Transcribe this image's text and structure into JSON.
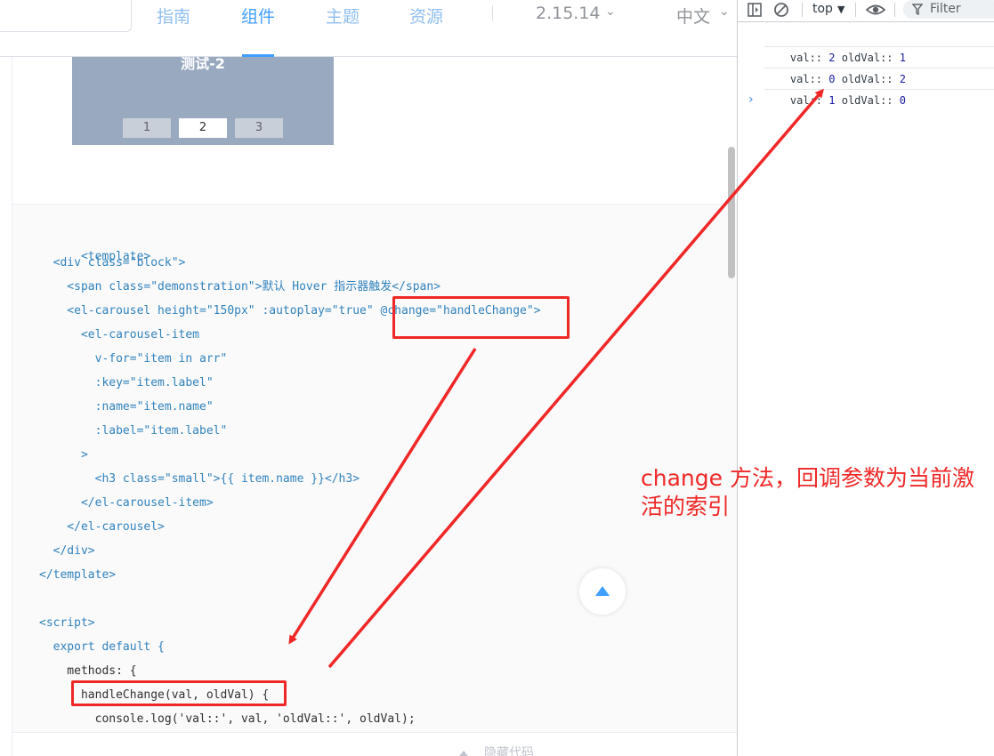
{
  "topnav": {
    "items": [
      "指南",
      "组件",
      "主题",
      "资源"
    ],
    "active_index": 1,
    "version": "2.15.14",
    "language": "中文"
  },
  "carousel": {
    "title": "测试-2",
    "indicators": [
      "1",
      "2",
      "3"
    ],
    "active_index": 1
  },
  "code": {
    "lines": [
      "<template>",
      "  <div class=\"block\">",
      "    <span class=\"demonstration\">默认 Hover 指示器触发</span>",
      "    <el-carousel height=\"150px\" :autoplay=\"true\" @change=\"handleChange\">",
      "      <el-carousel-item",
      "        v-for=\"item in arr\"",
      "        :key=\"item.label\"",
      "        :name=\"item.name\"",
      "        :label=\"item.label\"",
      "      >",
      "        <h3 class=\"small\">{{ item.name }}</h3>",
      "      </el-carousel-item>",
      "    </el-carousel>",
      "  </div>",
      "</template>",
      "",
      "<script>",
      "  export default {",
      "    methods: {",
      "      handleChange(val, oldVal) {",
      "        console.log('val::', val, 'oldVal::', oldVal);"
    ]
  },
  "footer": {
    "text": "隐藏代码"
  },
  "devtools": {
    "context": "top",
    "filter_placeholder": "Filter",
    "logs": [
      {
        "label1": "val::",
        "val": "2",
        "label2": "oldVal::",
        "old": "1"
      },
      {
        "label1": "val::",
        "val": "0",
        "label2": "oldVal::",
        "old": "2"
      },
      {
        "label1": "val::",
        "val": "1",
        "label2": "oldVal::",
        "old": "0"
      }
    ],
    "prompt": "›"
  },
  "annotation": {
    "text": "change 方法，回调参数为当前激活的索引",
    "color": "#f02727"
  },
  "colors": {
    "accent": "#409eff",
    "carousel_bg": "#99a9bf",
    "annotation_red": "#f02727"
  }
}
